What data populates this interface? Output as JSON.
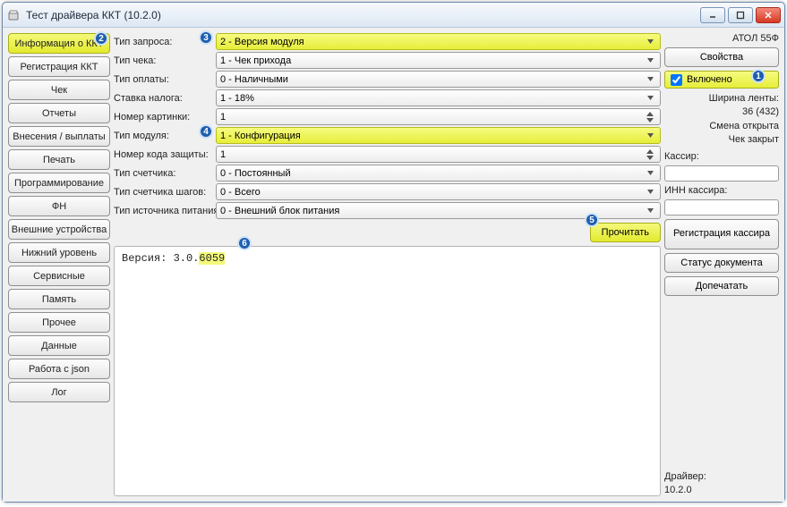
{
  "window": {
    "title": "Тест драйвера ККТ (10.2.0)"
  },
  "sidebar": {
    "items": [
      {
        "label": "Информация о ККТ",
        "selected": true
      },
      {
        "label": "Регистрация ККТ"
      },
      {
        "label": "Чек"
      },
      {
        "label": "Отчеты"
      },
      {
        "label": "Внесения / выплаты"
      },
      {
        "label": "Печать"
      },
      {
        "label": "Программирование"
      },
      {
        "label": "ФН"
      },
      {
        "label": "Внешние устройства"
      },
      {
        "label": "Нижний уровень"
      },
      {
        "label": "Сервисные"
      },
      {
        "label": "Память"
      },
      {
        "label": "Прочее"
      },
      {
        "label": "Данные"
      },
      {
        "label": "Работа с json"
      },
      {
        "label": "Лог"
      }
    ]
  },
  "form": {
    "request_type": {
      "label": "Тип запроса:",
      "value": "2 - Версия модуля",
      "highlight": true
    },
    "receipt_type": {
      "label": "Тип чека:",
      "value": "1 - Чек прихода"
    },
    "payment_type": {
      "label": "Тип оплаты:",
      "value": "0 - Наличными"
    },
    "tax_rate": {
      "label": "Ставка налога:",
      "value": "1 - 18%"
    },
    "picture_no": {
      "label": "Номер картинки:",
      "value": "1"
    },
    "module_type": {
      "label": "Тип модуля:",
      "value": "1 - Конфигурация",
      "highlight": true
    },
    "protection_code_no": {
      "label": "Номер кода защиты:",
      "value": "1"
    },
    "counter_type": {
      "label": "Тип счетчика:",
      "value": "0 - Постоянный"
    },
    "step_counter_type": {
      "label": "Тип счетчика шагов:",
      "value": "0 - Всего"
    },
    "power_source_type": {
      "label": "Тип источника питания:",
      "value": "0 - Внешний блок питания"
    }
  },
  "actions": {
    "read": "Прочитать"
  },
  "output": {
    "prefix": "Версия: 3.0.",
    "highlighted": "6059"
  },
  "right": {
    "device_name": "АТОЛ 55Ф",
    "properties_btn": "Свойства",
    "enabled_label": "Включено",
    "enabled_checked": true,
    "tape_width_label": "Ширина ленты:",
    "tape_width_value": "36 (432)",
    "shift_status": "Смена открыта",
    "receipt_status": "Чек закрыт",
    "cashier_label": "Кассир:",
    "cashier_value": "",
    "inn_label": "ИНН кассира:",
    "inn_value": "",
    "reg_cashier_btn": "Регистрация кассира",
    "doc_status_btn": "Статус документа",
    "reprint_btn": "Допечатать",
    "driver_label": "Драйвер:",
    "driver_version": "10.2.0"
  },
  "badges": {
    "b1": "1",
    "b2": "2",
    "b3": "3",
    "b4": "4",
    "b5": "5",
    "b6": "6"
  }
}
